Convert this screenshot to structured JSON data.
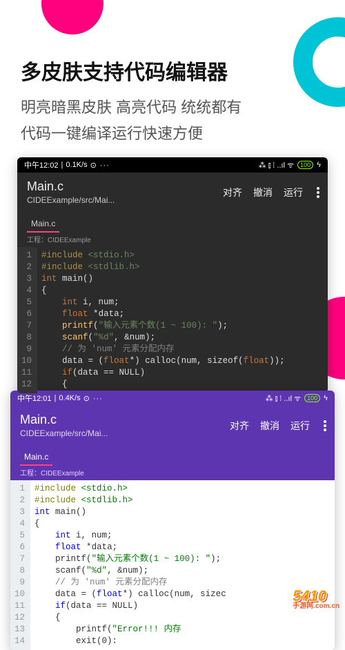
{
  "heading": {
    "title": "多皮肤支持代码编辑器",
    "subtitle1": "明亮暗黑皮肤 高亮代码 统统都有",
    "subtitle2": "代码一键编译运行快速方便"
  },
  "dark": {
    "status": {
      "time": "中午12:02",
      "net": "0.1K/s",
      "oper_icons": "⊙ ···",
      "right_icons": "⁂ ⫾ ⁞ ..ıl ᯤ",
      "battery": "100"
    },
    "appbar": {
      "title": "Main.c",
      "path": "CIDEExample/src/Mai...",
      "actions": [
        "对齐",
        "撤消",
        "运行"
      ]
    },
    "tab": "Main.c",
    "project_label": "工程：CIDEExample",
    "lines": [
      "1",
      "2",
      "3",
      "4",
      "5",
      "6",
      "7",
      "8",
      "9",
      "10",
      "11",
      "12"
    ]
  },
  "light": {
    "status": {
      "time": "中午12:01",
      "net": "0.4K/s",
      "oper_icons": "⊙ ···",
      "right_icons": "⁂ ⫾ ⁞ ..ıl ᯤ",
      "battery": "100"
    },
    "appbar": {
      "title": "Main.c",
      "path": "CIDEExample/src/Mai...",
      "actions": [
        "对齐",
        "撤消",
        "运行"
      ]
    },
    "tab": "Main.c",
    "project_label": "工程：CIDEExample",
    "lines": [
      "1",
      "2",
      "3",
      "4",
      "5",
      "6",
      "7",
      "8",
      "9",
      "10",
      "11",
      "12",
      "13",
      "14"
    ]
  },
  "code": {
    "include1_a": "#include ",
    "include1_b": "<stdio.h>",
    "include2_a": "#include ",
    "include2_b": "<stdlib.h>",
    "int": "int",
    "main": " main()",
    "lbrace": "{",
    "decl_int": "int",
    "decl_int_rest": " i, num;",
    "decl_float": "float",
    "star": " *",
    "data_semi": "data;",
    "printf": "printf",
    "prompt": "\"输入元素个数(1 ~ 100): \"",
    "close_paren": ");",
    "scanf": "scanf",
    "scanf_fmt": "\"%d\"",
    "scanf_rest": ", &num);",
    "comment": "// 为 'num' 元素分配内存",
    "assign_a": "data = (",
    "float_cast": "float",
    "assign_b_dark": "*) calloc(num, sizeof(",
    "assign_c_dark": "));",
    "assign_b_light": "*) calloc(num, sizec",
    "if": "if",
    "if_cond": "(data == NULL)",
    "lbrace2": "{",
    "printf2": "printf(",
    "err_str": "\"Error!!! 内存",
    "exit_call": "exit(0):"
  },
  "watermark": {
    "main": "5410",
    "sub": "手游网",
    "url": ".com.cn"
  }
}
